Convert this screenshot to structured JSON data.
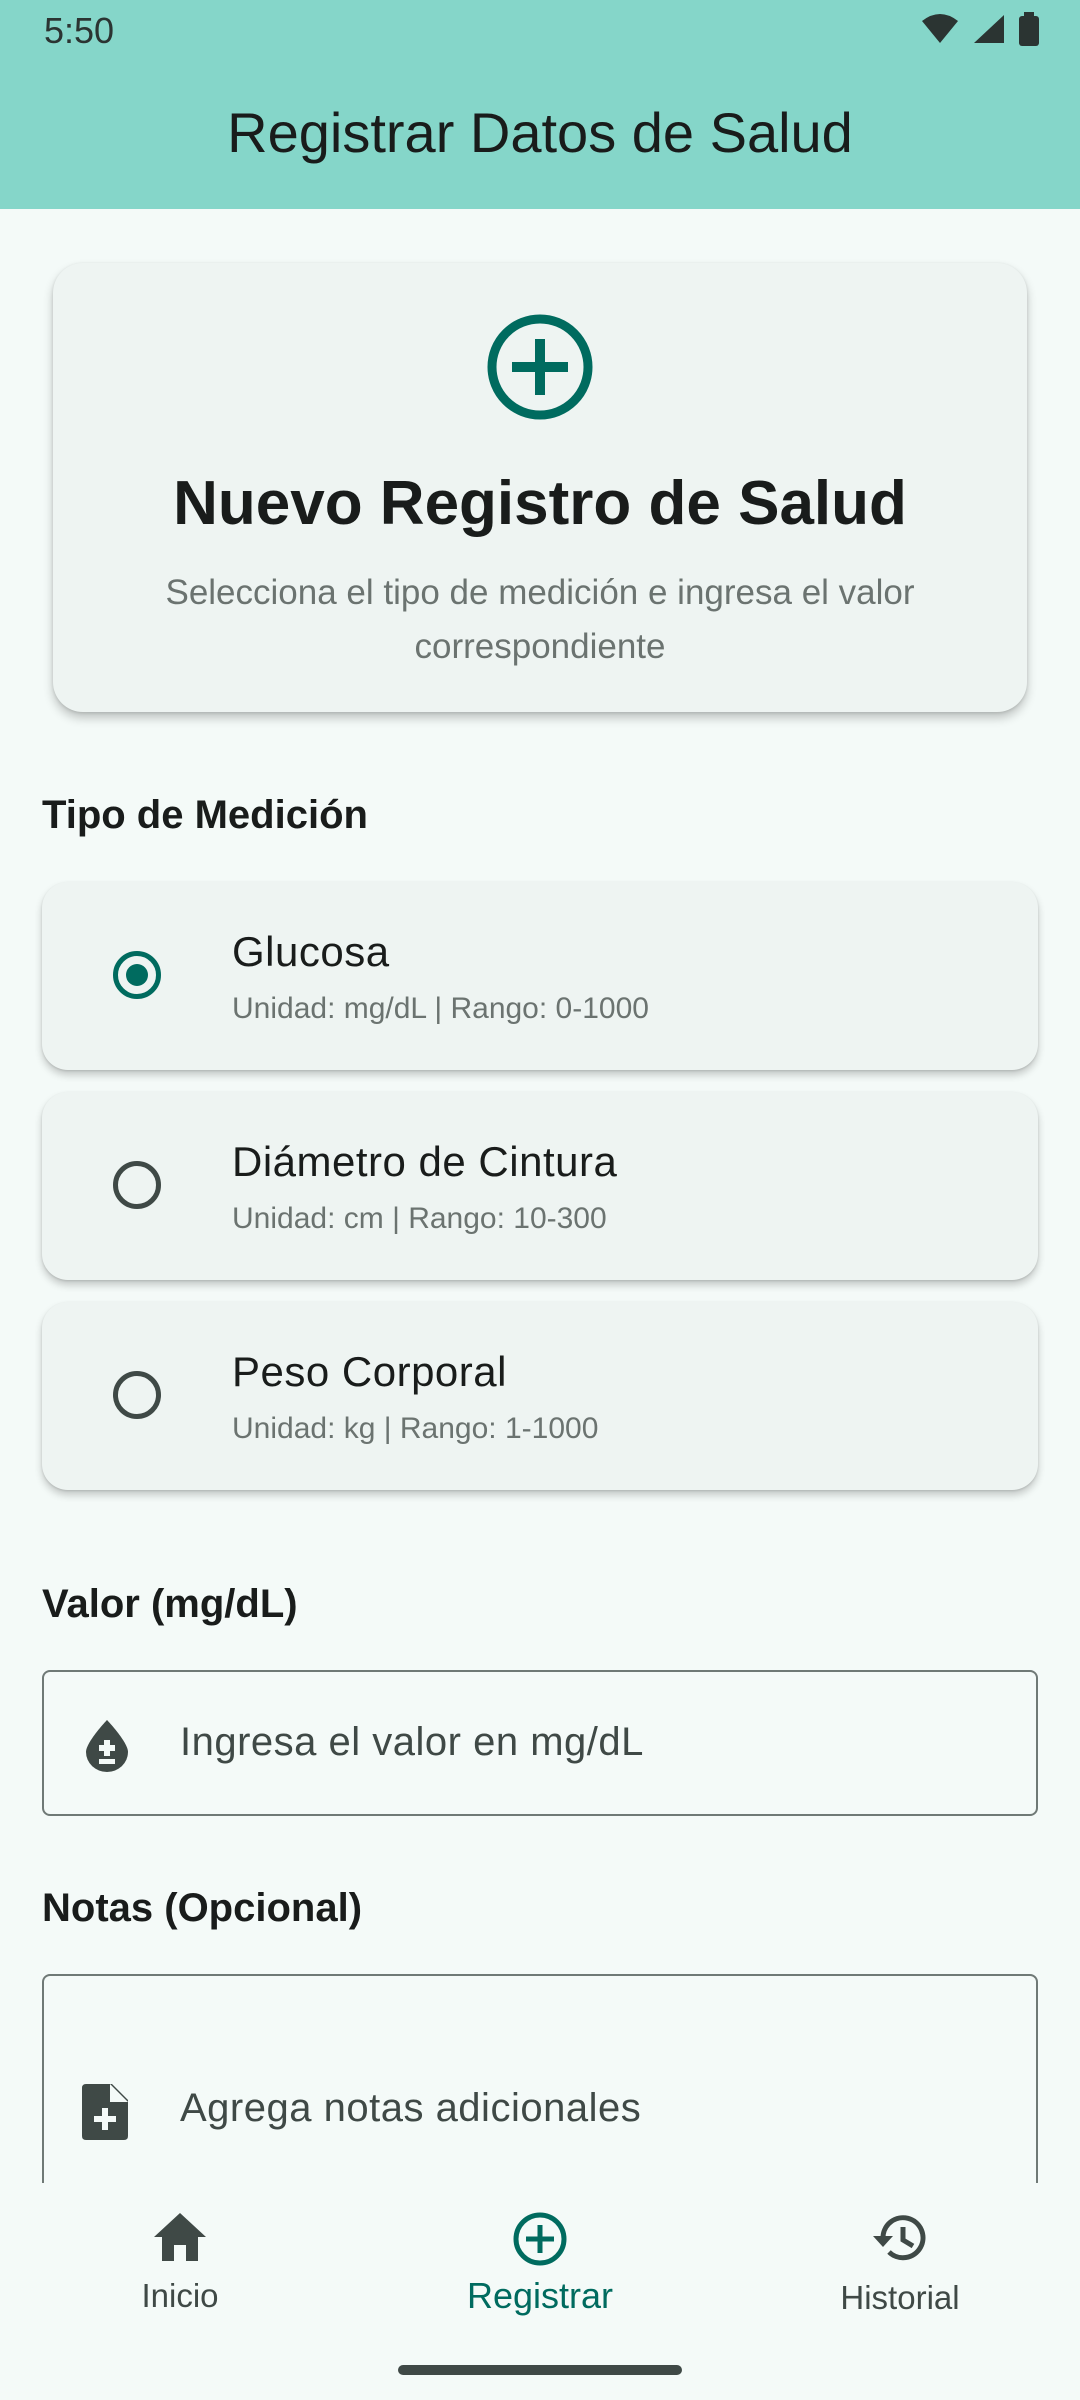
{
  "status_bar": {
    "time": "5:50"
  },
  "app_bar": {
    "title": "Registrar Datos de Salud"
  },
  "header_card": {
    "title": "Nuevo Registro de Salud",
    "subtitle": "Selecciona el tipo de medición e ingresa el valor correspondiente"
  },
  "measurement_type": {
    "label": "Tipo de Medición",
    "options": [
      {
        "title": "Glucosa",
        "subtitle": "Unidad: mg/dL | Rango: 0-1000",
        "selected": true
      },
      {
        "title": "Diámetro de Cintura",
        "subtitle": "Unidad: cm | Rango: 10-300",
        "selected": false
      },
      {
        "title": "Peso Corporal",
        "subtitle": "Unidad: kg | Rango: 1-1000",
        "selected": false
      }
    ]
  },
  "value_field": {
    "label": "Valor (mg/dL)",
    "placeholder": "Ingresa el valor en mg/dL",
    "icon": "blood-drop-icon"
  },
  "notes_field": {
    "label": "Notas (Opcional)",
    "placeholder": "Agrega notas adicionales",
    "icon": "note-add-icon"
  },
  "bottom_nav": {
    "items": [
      {
        "label": "Inicio",
        "icon": "home-icon",
        "active": false
      },
      {
        "label": "Registrar",
        "icon": "add-circle-icon",
        "active": true
      },
      {
        "label": "Historial",
        "icon": "history-icon",
        "active": false
      }
    ]
  },
  "colors": {
    "primary": "#006B5F",
    "app_bar": "#85D6C9",
    "background": "#F4FAF8",
    "card": "#EEF4F2"
  }
}
